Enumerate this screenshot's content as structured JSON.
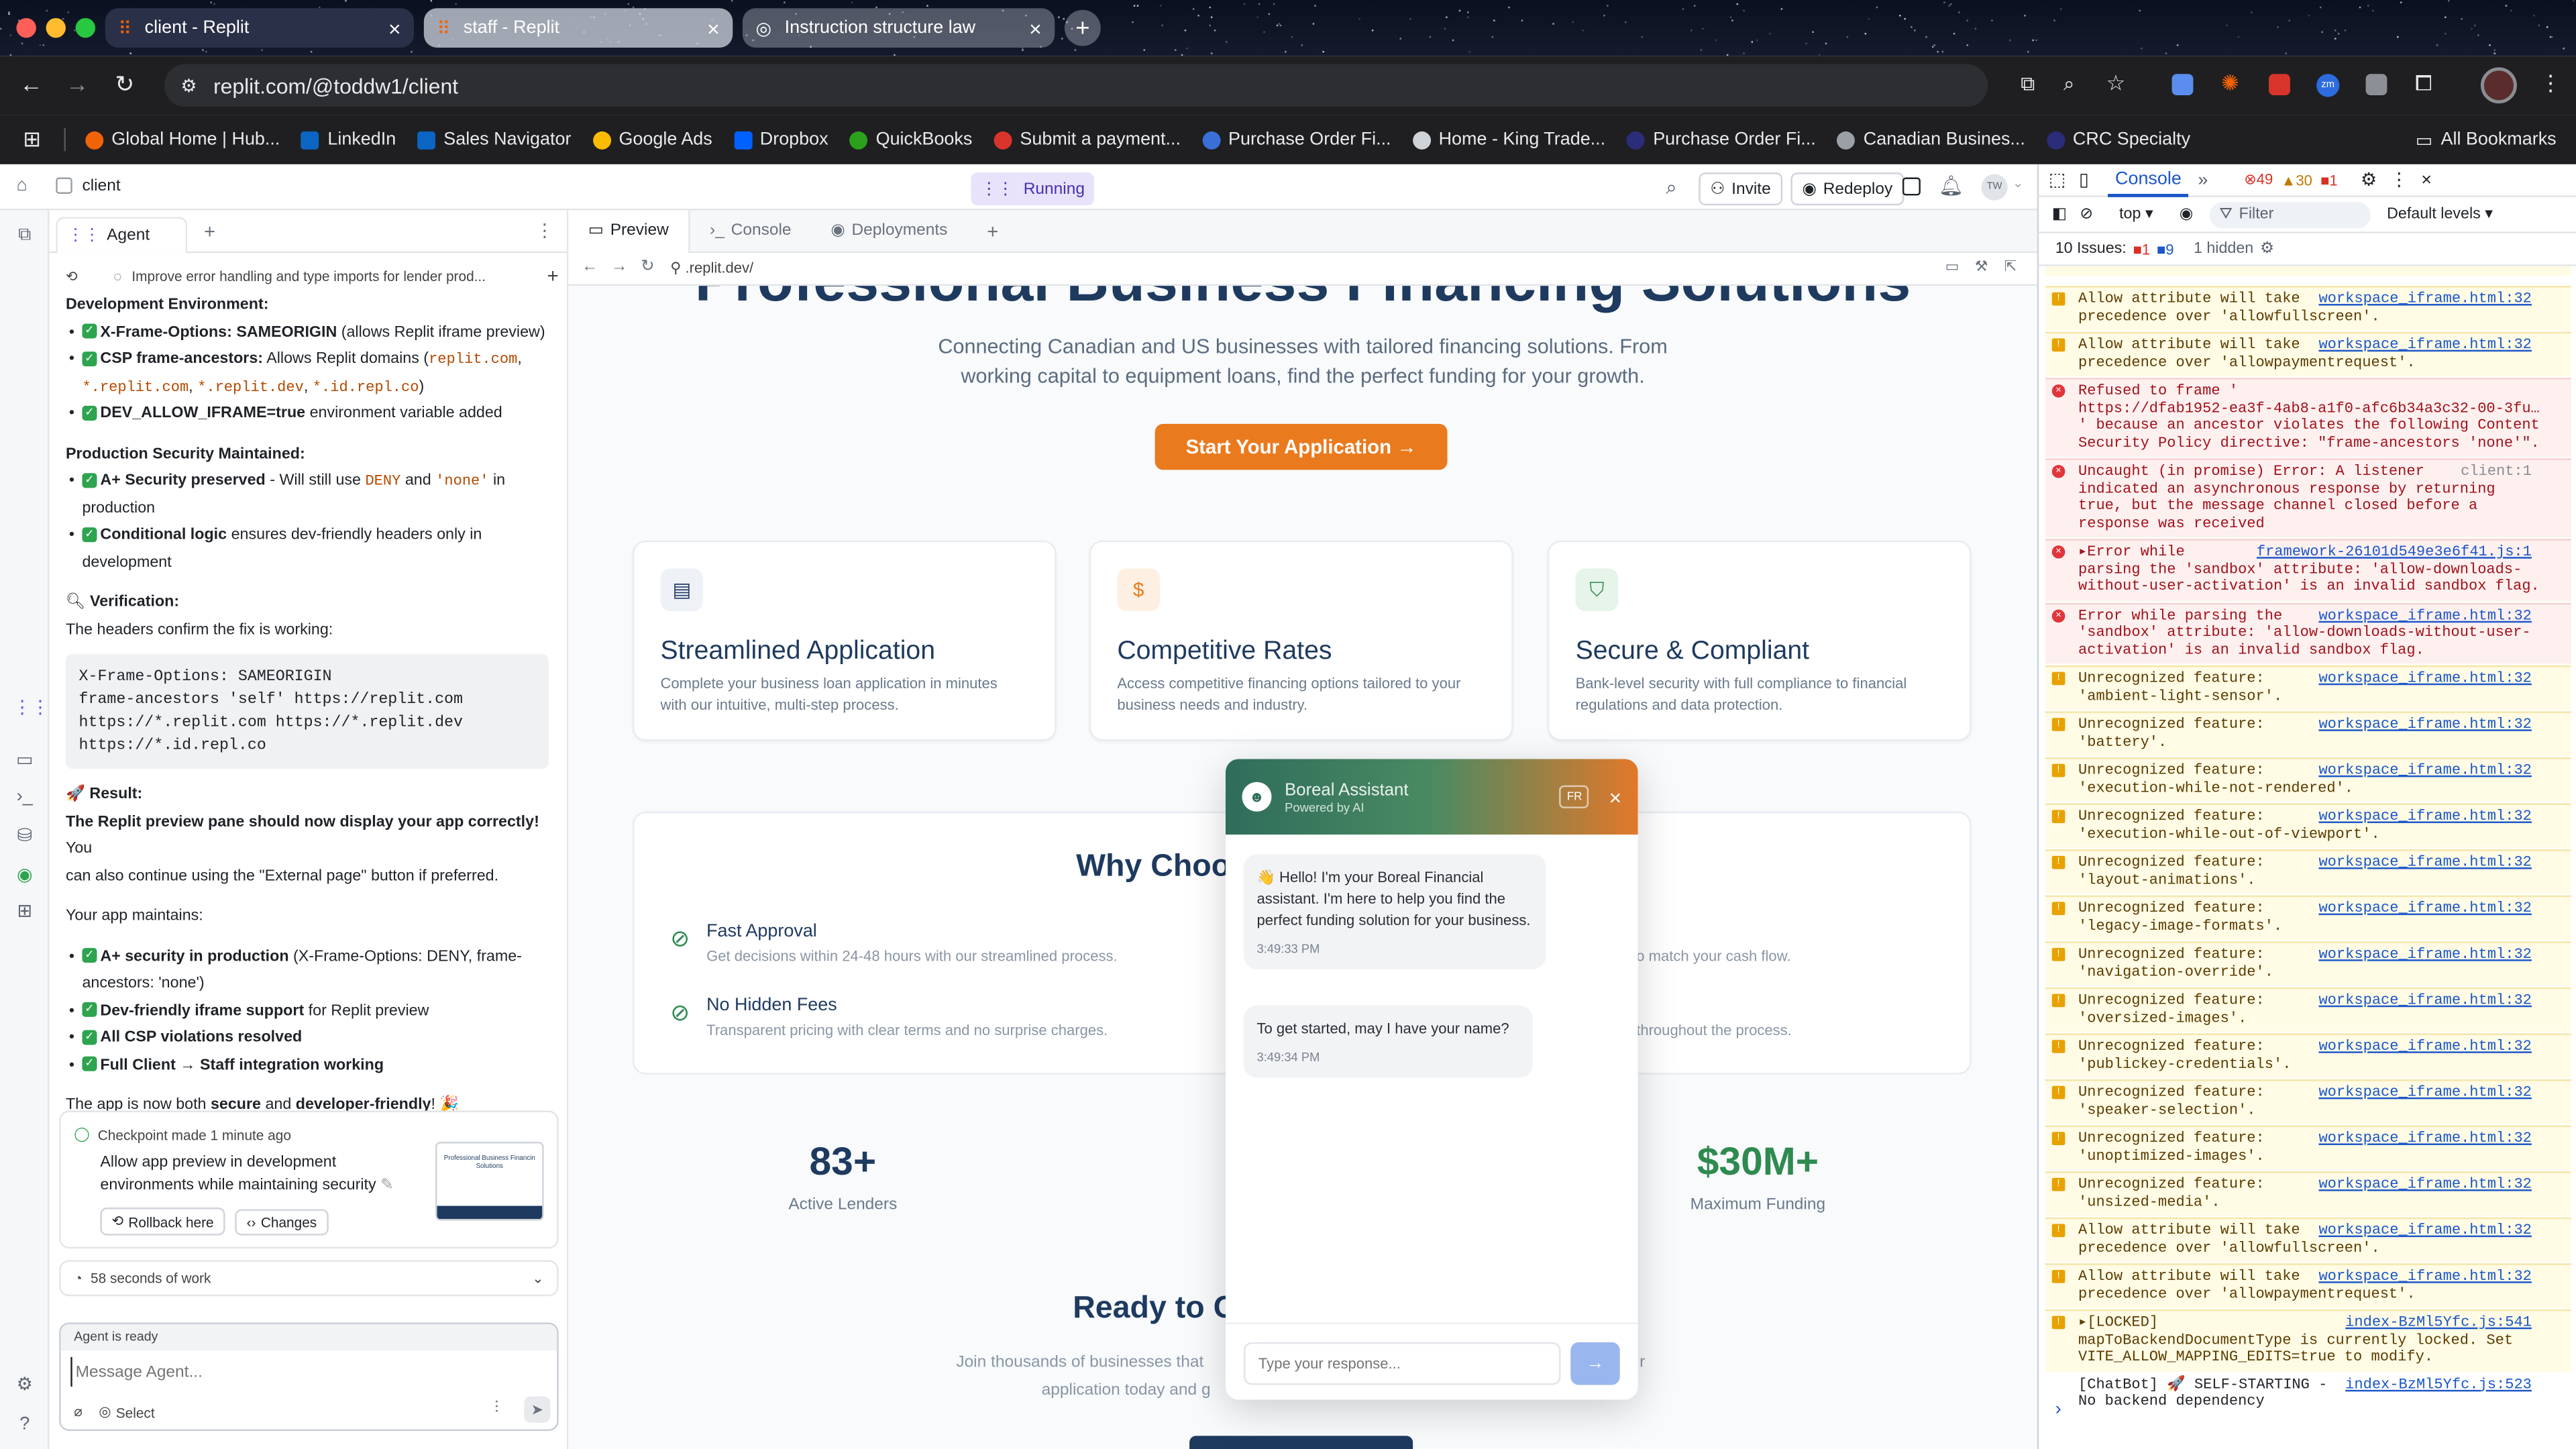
{
  "browser": {
    "tabs": [
      {
        "label": "client - Replit",
        "active": true
      },
      {
        "label": "staff - Replit",
        "active": false
      },
      {
        "label": "Instruction structure law",
        "active": false
      }
    ],
    "url": "replit.com/@toddw1/client",
    "bookmarks": [
      "Global Home | Hub...",
      "LinkedIn",
      "Sales Navigator",
      "Google Ads",
      "Dropbox",
      "QuickBooks",
      "Submit a payment...",
      "Purchase Order Fi...",
      "Home - King Trade...",
      "Purchase Order Fi...",
      "Canadian Busines...",
      "CRC Specialty"
    ],
    "all_bookmarks": "All Bookmarks"
  },
  "replit": {
    "project": "client",
    "status": "Running",
    "invite": "Invite",
    "redeploy": "Redeploy",
    "avatar": "TW"
  },
  "agent": {
    "tab": "Agent",
    "thread_title": "Improve error handling and type imports for lender prod...",
    "env_heading": "Development Environment:",
    "env": {
      "xfo_bold": "X-Frame-Options: SAMEORIGIN",
      "xfo_rest": " (allows Replit iframe preview)",
      "csp_bold": "CSP frame-ancestors:",
      "csp_rest": " Allows Replit domains (",
      "csp_code1": "replit.com",
      "csp_sep1": ",",
      "csp_code2": "*.replit.com",
      "csp_sep2": ",",
      "csp_code3": "*.replit.dev",
      "csp_sep3": ",",
      "csp_code4": "*.id.repl.co",
      "csp_end": ")",
      "dev_bold": "DEV_ALLOW_IFRAME=true",
      "dev_rest": " environment variable added"
    },
    "prod_heading": "Production Security Maintained:",
    "prod": {
      "a_bold": "A+ Security preserved",
      "a_rest": " - Will still use ",
      "a_code1": "DENY",
      "a_and": " and ",
      "a_code2": "'none'",
      "a_in": " in",
      "a_tail": "production",
      "c_bold": "Conditional logic",
      "c_rest": " ensures dev-friendly headers only in",
      "c_tail": "development"
    },
    "verification_heading": "Verification:",
    "verification_text": "The headers confirm the fix is working:",
    "code_lines": [
      "X-Frame-Options: SAMEORIGIN",
      "frame-ancestors 'self' https://replit.com",
      "https://*.replit.com https://*.replit.dev",
      "https://*.id.repl.co"
    ],
    "result_heading": "Result:",
    "result_bold": "The Replit preview pane should now display your app correctly!",
    "result_rest": " You",
    "result_line2": "can also continue using the \"External page\" button if preferred.",
    "maintains": "Your app maintains:",
    "m": {
      "m1_bold": "A+ security in production",
      "m1_rest": " (X-Frame-Options: DENY, frame-",
      "m1_tail": "ancestors: 'none')",
      "m2_bold": "Dev-friendly iframe support",
      "m2_rest": " for Replit preview",
      "m3_bold": "All CSP violations resolved",
      "m4_bold": "Full Client → Staff integration working"
    },
    "final_a": "The app is now both ",
    "final_b": "secure",
    "final_c": " and ",
    "final_d": "developer-friendly",
    "final_e": "! 🎉",
    "checkpoint": {
      "time": "Checkpoint made 1 minute ago",
      "line1": "Allow app preview in development",
      "line2": "environments while maintaining security",
      "thumb_title": "Professional Business Financin Solutions",
      "rollback": "Rollback here",
      "changes": "Changes"
    },
    "work": "58 seconds of work",
    "ready": "Agent is ready",
    "placeholder": "Message Agent...",
    "select": "Select"
  },
  "preview": {
    "tabs": [
      "Preview",
      "Console",
      "Deployments"
    ],
    "url": ".replit.dev/"
  },
  "site": {
    "hero_title": "Professional Business Financing Solutions",
    "hero_sub1": "Connecting Canadian and US businesses with tailored financing solutions. From",
    "hero_sub2": "working capital to equipment loans, find the perfect funding for your growth.",
    "cta": "Start Your Application →",
    "features": [
      {
        "title": "Streamlined Application",
        "d1": "Complete your business loan application in minutes",
        "d2": "with our intuitive, multi-step process.",
        "icon": "document-icon"
      },
      {
        "title": "Competitive Rates",
        "d1": "Access competitive financing options tailored to your",
        "d2": "business needs and industry.",
        "icon": "dollar-icon"
      },
      {
        "title": "Secure & Compliant",
        "d1": "Bank-level security with full compliance to financial",
        "d2": "regulations and data protection.",
        "icon": "shield-icon"
      }
    ],
    "why_title": "Why Choo",
    "why": [
      {
        "title": "Fast Approval",
        "desc": "Get decisions within 24-48 hours with our streamlined process."
      },
      {
        "title": "No Hidden Fees",
        "desc": "Transparent pricing with clear terms and no surprise charges."
      }
    ],
    "why_right": [
      "o match your cash flow.",
      "throughout the process."
    ],
    "stats": [
      {
        "value": "83+",
        "label": "Active Lenders",
        "color": "#1e3a5f"
      },
      {
        "value": "$30M+",
        "label": "Maximum Funding",
        "color": "#2f8a4f"
      }
    ],
    "ready_title": "Ready to G",
    "ready_sub1": "Join thousands of businesses that",
    "ready_sub1b": "r",
    "ready_sub2": "application today and g",
    "accent": "#ea7a1e"
  },
  "chatbot": {
    "title": "Boreal Assistant",
    "subtitle": "Powered by AI",
    "lang": "FR",
    "messages": [
      {
        "text": "👋 Hello! I'm your Boreal Financial assistant. I'm here to help you find the perfect funding solution for your business.",
        "time": "3:49:33 PM"
      },
      {
        "text": "To get started, may I have your name?",
        "time": "3:49:34 PM"
      }
    ],
    "placeholder": "Type your response..."
  },
  "devtools": {
    "tab": "Console",
    "counts": {
      "errors": "49",
      "warnings": "30",
      "issues": "1"
    },
    "context": "top ▾",
    "filter": "Filter",
    "levels": "Default levels ▾",
    "issues_label": "10 Issues:",
    "issues_err": "1",
    "issues_info": "9",
    "hidden": "1 hidden",
    "lines": [
      {
        "t": "warn",
        "msg": "Allow attribute will take\nprecedence over 'allowfullscreen'.",
        "src": "workspace_iframe.html:32"
      },
      {
        "t": "warn",
        "msg": "Allow attribute will take\nprecedence over 'allowpaymentrequest'.",
        "src": "workspace_iframe.html:32"
      },
      {
        "t": "err",
        "msg": "Refused to frame '\nhttps://dfab1952-ea3f-4ab8-a1f0-afc6b34a3c32-00-3fu…\n' because an ancestor violates the following Content\nSecurity Policy directive: \"frame-ancestors 'none'\".",
        "src": ""
      },
      {
        "t": "err",
        "msg": "Uncaught (in promise) Error: A listener\nindicated an asynchronous response by returning\ntrue, but the message channel closed before a\nresponse was received",
        "src": "client:1"
      },
      {
        "t": "err",
        "msg": "▸Error while\nparsing the 'sandbox' attribute: 'allow-downloads-\nwithout-user-activation' is an invalid sandbox flag.",
        "src": "framework-26101d549e3e6f41.js:1"
      },
      {
        "t": "err",
        "msg": "Error while parsing the\n'sandbox' attribute: 'allow-downloads-without-user-\nactivation' is an invalid sandbox flag.",
        "src": "workspace_iframe.html:32"
      },
      {
        "t": "warn",
        "msg": "Unrecognized feature:\n'ambient-light-sensor'.",
        "src": "workspace_iframe.html:32"
      },
      {
        "t": "warn",
        "msg": "Unrecognized feature:\n'battery'.",
        "src": "workspace_iframe.html:32"
      },
      {
        "t": "warn",
        "msg": "Unrecognized feature:\n'execution-while-not-rendered'.",
        "src": "workspace_iframe.html:32"
      },
      {
        "t": "warn",
        "msg": "Unrecognized feature:\n'execution-while-out-of-viewport'.",
        "src": "workspace_iframe.html:32"
      },
      {
        "t": "warn",
        "msg": "Unrecognized feature:\n'layout-animations'.",
        "src": "workspace_iframe.html:32"
      },
      {
        "t": "warn",
        "msg": "Unrecognized feature:\n'legacy-image-formats'.",
        "src": "workspace_iframe.html:32"
      },
      {
        "t": "warn",
        "msg": "Unrecognized feature:\n'navigation-override'.",
        "src": "workspace_iframe.html:32"
      },
      {
        "t": "warn",
        "msg": "Unrecognized feature:\n'oversized-images'.",
        "src": "workspace_iframe.html:32"
      },
      {
        "t": "warn",
        "msg": "Unrecognized feature:\n'publickey-credentials'.",
        "src": "workspace_iframe.html:32"
      },
      {
        "t": "warn",
        "msg": "Unrecognized feature:\n'speaker-selection'.",
        "src": "workspace_iframe.html:32"
      },
      {
        "t": "warn",
        "msg": "Unrecognized feature:\n'unoptimized-images'.",
        "src": "workspace_iframe.html:32"
      },
      {
        "t": "warn",
        "msg": "Unrecognized feature:\n'unsized-media'.",
        "src": "workspace_iframe.html:32"
      },
      {
        "t": "warn",
        "msg": "Allow attribute will take\nprecedence over 'allowfullscreen'.",
        "src": "workspace_iframe.html:32"
      },
      {
        "t": "warn",
        "msg": "Allow attribute will take\nprecedence over 'allowpaymentrequest'.",
        "src": "workspace_iframe.html:32"
      },
      {
        "t": "warn",
        "msg": "▸[LOCKED]\nmapToBackendDocumentType is currently locked. Set\nVITE_ALLOW_MAPPING_EDITS=true to modify.",
        "src": "index-BzMl5Yfc.js:541"
      },
      {
        "t": "info",
        "msg": "[ChatBot] 🚀 SELF-STARTING -\nNo backend dependency",
        "src": "index-BzMl5Yfc.js:523"
      }
    ]
  }
}
